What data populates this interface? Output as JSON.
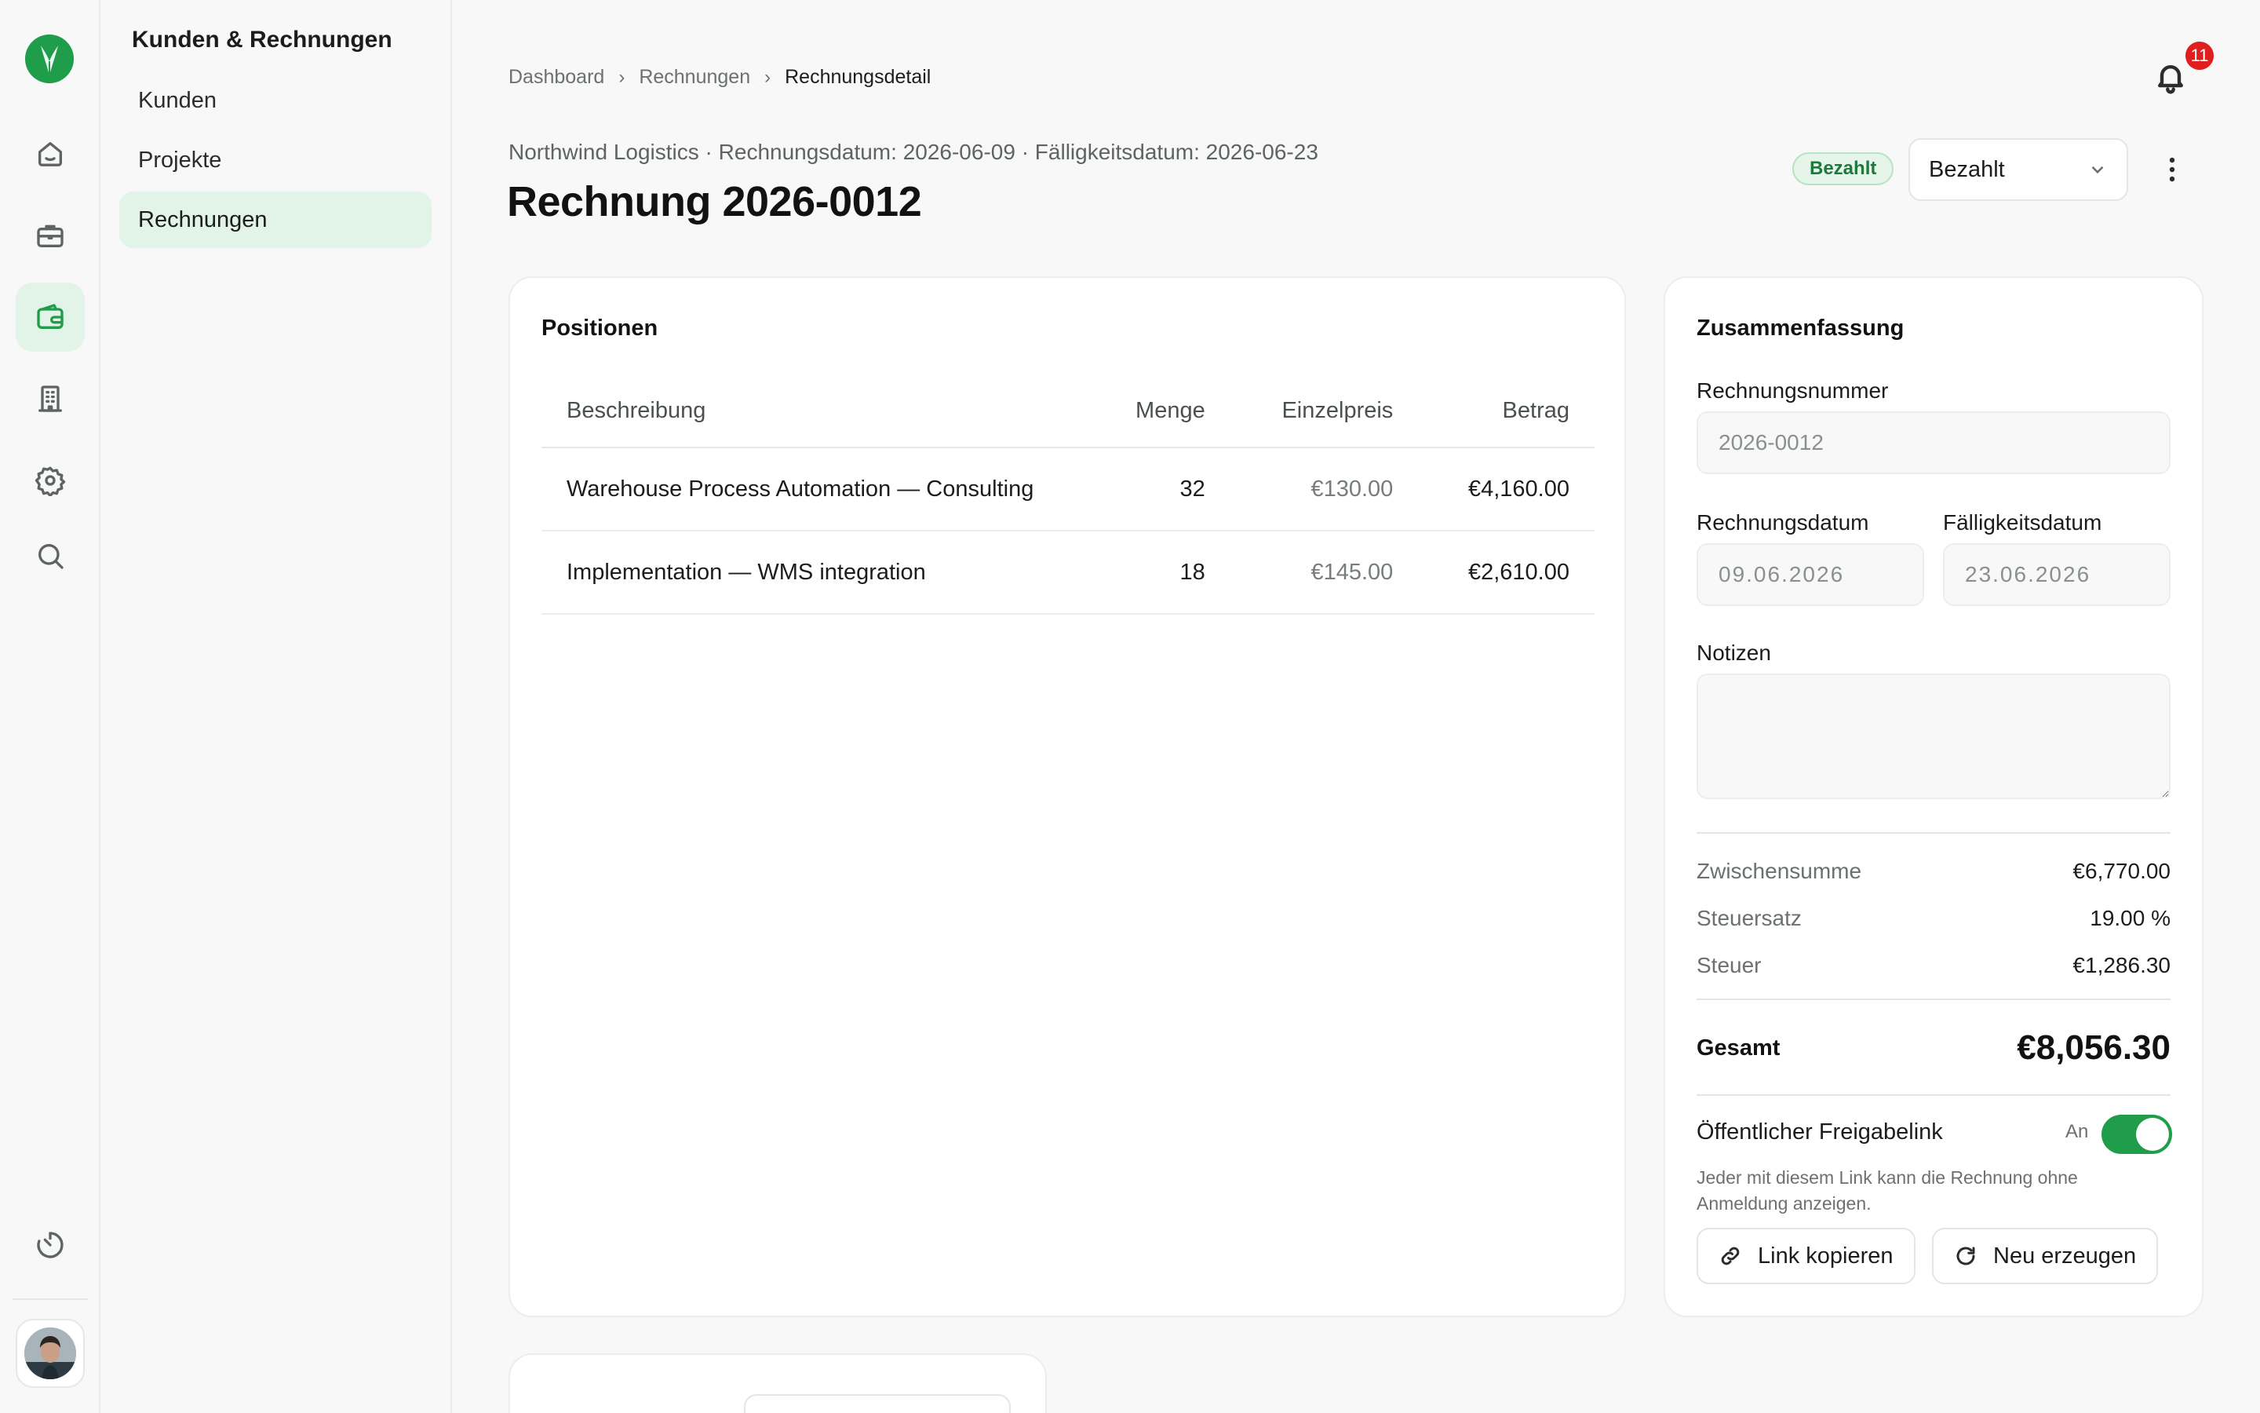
{
  "rail": {
    "items": [
      {
        "name": "home-icon"
      },
      {
        "name": "briefcase-icon"
      },
      {
        "name": "wallet-icon",
        "active": true
      },
      {
        "name": "building-icon"
      },
      {
        "name": "gear-icon"
      },
      {
        "name": "search-icon"
      }
    ],
    "bottom_icon": "timer-icon",
    "brand_color": "#1f9d4a"
  },
  "sidebar": {
    "title": "Kunden & Rechnungen",
    "items": [
      {
        "label": "Kunden"
      },
      {
        "label": "Projekte"
      },
      {
        "label": "Rechnungen",
        "active": true
      }
    ]
  },
  "breadcrumb": {
    "items": [
      "Dashboard",
      "Rechnungen",
      "Rechnungsdetail"
    ]
  },
  "notifications": {
    "count": "11"
  },
  "invoice": {
    "meta": "Northwind Logistics · Rechnungsdatum: 2026-06-09 · Fälligkeitsdatum: 2026-06-23",
    "title": "Rechnung 2026-0012",
    "status_badge": "Bezahlt",
    "status_select": "Bezahlt"
  },
  "positions": {
    "title": "Positionen",
    "columns": [
      "Beschreibung",
      "Menge",
      "Einzelpreis",
      "Betrag"
    ],
    "rows": [
      {
        "description": "Warehouse Process Automation — Consulting",
        "qty": "32",
        "unit_price": "€130.00",
        "amount": "€4,160.00"
      },
      {
        "description": "Implementation — WMS integration",
        "qty": "18",
        "unit_price": "€145.00",
        "amount": "€2,610.00"
      }
    ]
  },
  "summary": {
    "title": "Zusammenfassung",
    "invoice_number_label": "Rechnungsnummer",
    "invoice_number_value": "2026-0012",
    "invoice_date_label": "Rechnungsdatum",
    "invoice_date_value": "09.06.2026",
    "due_date_label": "Fälligkeitsdatum",
    "due_date_value": "23.06.2026",
    "notes_label": "Notizen",
    "notes_value": "",
    "subtotal_label": "Zwischensumme",
    "subtotal_value": "€6,770.00",
    "tax_rate_label": "Steuersatz",
    "tax_rate_value": "19.00 %",
    "tax_label": "Steuer",
    "tax_value": "€1,286.30",
    "total_label": "Gesamt",
    "total_value": "€8,056.30",
    "share_label": "Öffentlicher Freigabelink",
    "share_state": "An",
    "share_enabled": true,
    "share_help": "Jeder mit diesem Link kann die Rechnung ohne Anmeldung anzeigen.",
    "copy_link_label": "Link kopieren",
    "regenerate_label": "Neu erzeugen"
  }
}
